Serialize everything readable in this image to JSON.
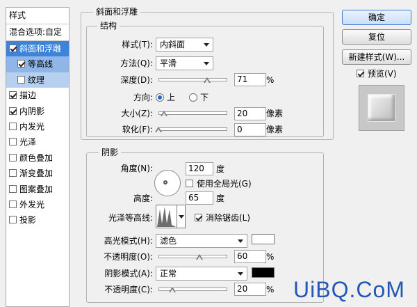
{
  "left_panel": {
    "header": "样式",
    "blending_options": "混合选项:自定",
    "items": [
      {
        "label": "斜面和浮雕",
        "checked": true
      },
      {
        "label": "等高线",
        "checked": true
      },
      {
        "label": "纹理",
        "checked": false
      },
      {
        "label": "描边",
        "checked": true
      },
      {
        "label": "内阴影",
        "checked": true
      },
      {
        "label": "内发光",
        "checked": false
      },
      {
        "label": "光泽",
        "checked": false
      },
      {
        "label": "颜色叠加",
        "checked": false
      },
      {
        "label": "渐变叠加",
        "checked": false
      },
      {
        "label": "图案叠加",
        "checked": false
      },
      {
        "label": "外发光",
        "checked": false
      },
      {
        "label": "投影",
        "checked": false
      }
    ]
  },
  "bevel": {
    "section_title": "斜面和浮雕",
    "structure_title": "结构",
    "style_label": "样式(T):",
    "style_value": "内斜面",
    "technique_label": "方法(Q):",
    "technique_value": "平滑",
    "depth_label": "深度(D):",
    "depth_value": "71",
    "depth_unit": "%",
    "depth_level": 0.71,
    "direction_label": "方向:",
    "direction_up": "上",
    "direction_down": "下",
    "size_label": "大小(Z):",
    "size_value": "20",
    "size_unit": "像素",
    "size_level": 0.08,
    "soften_label": "软化(F):",
    "soften_value": "0",
    "soften_unit": "像素",
    "soften_level": 0.0
  },
  "shading": {
    "title": "阴影",
    "angle_label": "角度(N):",
    "angle_value": "120",
    "angle_unit": "度",
    "global_light_label": "使用全局光(G)",
    "global_light_checked": false,
    "altitude_label": "高度:",
    "altitude_value": "65",
    "altitude_unit": "度",
    "gloss_contour_label": "光泽等高线:",
    "anti_alias_label": "消除锯齿(L)",
    "anti_alias_checked": true,
    "highlight_mode_label": "高光模式(H):",
    "highlight_mode_value": "滤色",
    "highlight_color": "#ffffff",
    "highlight_opacity_label": "不透明度(O):",
    "highlight_opacity_value": "60",
    "highlight_opacity_unit": "%",
    "highlight_opacity_level": 0.6,
    "shadow_mode_label": "阴影模式(A):",
    "shadow_mode_value": "正常",
    "shadow_color": "#000000",
    "shadow_opacity_label": "不透明度(C):",
    "shadow_opacity_value": "20",
    "shadow_opacity_unit": "%",
    "shadow_opacity_level": 0.2
  },
  "buttons": {
    "ok": "确定",
    "reset": "复位",
    "new_style": "新建样式(W)...",
    "preview_label": "预览(V)",
    "preview_checked": true
  },
  "watermark": "UiBQ.CoM",
  "colors": {
    "selection": "#3d83d8",
    "selection_sub": "#8fb6e6",
    "watermark": "#2457b5"
  }
}
